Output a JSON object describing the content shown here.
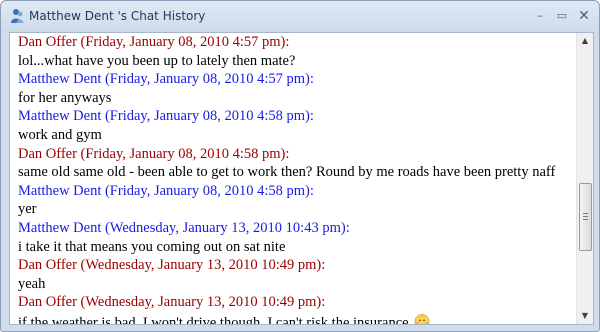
{
  "window": {
    "title": "Matthew Dent 's Chat History",
    "controls": {
      "minimize_icon": "minimize-icon",
      "maximize_icon": "maximize-icon",
      "close_icon": "close-icon",
      "minimize": "–",
      "maximize": "▭",
      "close": "✕"
    }
  },
  "colors": {
    "dan_offer": "#990000",
    "matthew_dent": "#1a1ae6",
    "text": "#000000"
  },
  "messages": [
    {
      "header": "Dan Offer (Friday, January 08, 2010 4:57 pm):",
      "speaker": "dan_offer",
      "text": "lol...what have you been up to lately then mate?"
    },
    {
      "header": "Matthew Dent (Friday, January 08, 2010 4:57 pm):",
      "speaker": "matthew_dent",
      "text": "for her anyways"
    },
    {
      "header": "Matthew Dent (Friday, January 08, 2010 4:58 pm):",
      "speaker": "matthew_dent",
      "text": "work and gym"
    },
    {
      "header": "Dan Offer (Friday, January 08, 2010 4:58 pm):",
      "speaker": "dan_offer",
      "text": "same old same old - been able to get to work then? Round by me roads have been pretty naff"
    },
    {
      "header": "Matthew Dent (Friday, January 08, 2010 4:58 pm):",
      "speaker": "matthew_dent",
      "text": "yer"
    },
    {
      "header": "Matthew Dent (Wednesday, January 13, 2010 10:43 pm):",
      "speaker": "matthew_dent",
      "text": "i take it that means you coming out on sat nite"
    },
    {
      "header": "Dan Offer (Wednesday, January 13, 2010 10:49 pm):",
      "speaker": "dan_offer",
      "text": "yeah"
    },
    {
      "header": "Dan Offer (Wednesday, January 13, 2010 10:49 pm):",
      "speaker": "dan_offer",
      "text": "if the weather is bad, I won't drive though, I can't risk the insurance",
      "emoticon": "blushing-smiley-icon"
    }
  ],
  "scrollbar": {
    "up_arrow": "▲",
    "down_arrow": "▼",
    "position": 0.62
  }
}
